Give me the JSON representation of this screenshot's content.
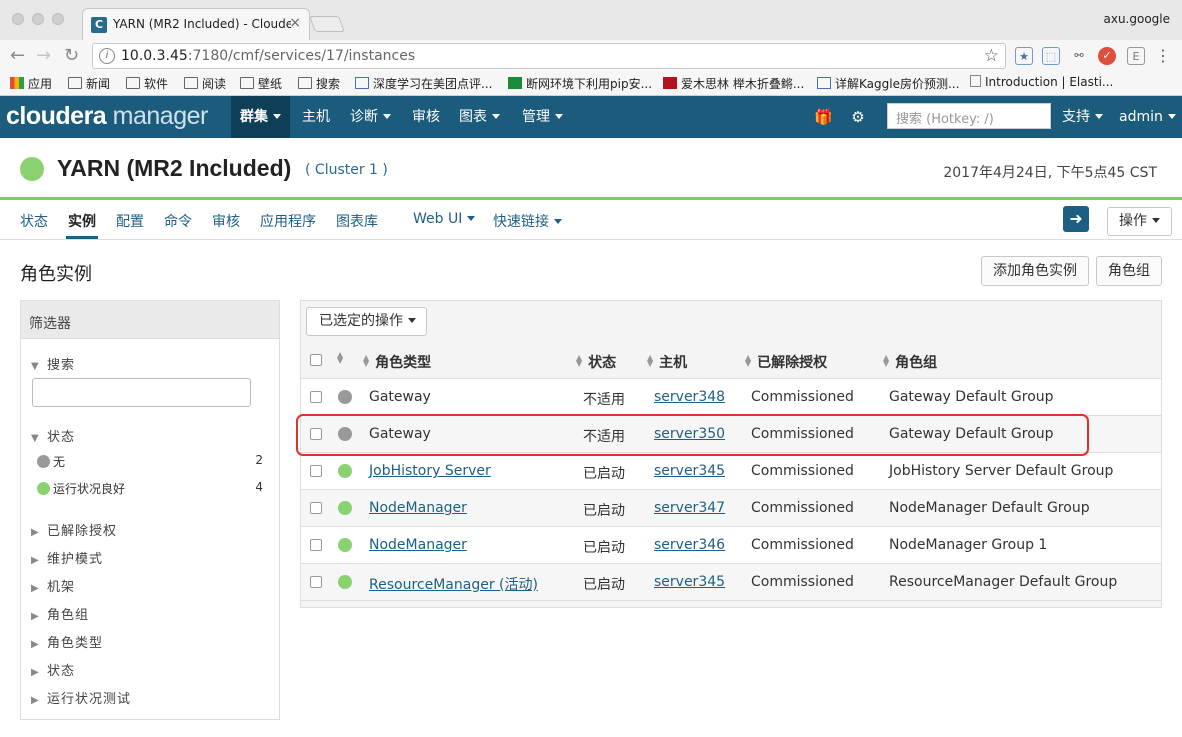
{
  "browser": {
    "tab_title": "YARN (MR2 Included) - Cloude",
    "tab_favicon": "C",
    "profile": "axu.google",
    "url_host": "10.0.3.45",
    "url_rest": ":7180/cmf/services/17/instances",
    "bookmarks": [
      {
        "label": "应用",
        "icon": "apps-icon"
      },
      {
        "label": "新闻",
        "icon": "folder-icon"
      },
      {
        "label": "软件",
        "icon": "folder-icon"
      },
      {
        "label": "阅读",
        "icon": "folder-icon"
      },
      {
        "label": "壁纸",
        "icon": "folder-icon"
      },
      {
        "label": "搜索",
        "icon": "folder-icon"
      },
      {
        "label": "深度学习在美团点评...",
        "icon": "chart-icon"
      },
      {
        "label": "断网环境下利用pip安...",
        "icon": "sf-icon"
      },
      {
        "label": "爱木思林 榉木折叠鳉...",
        "icon": "t-icon"
      },
      {
        "label": "详解Kaggle房价预测...",
        "icon": "chart-icon"
      },
      {
        "label": "Introduction | Elasti...",
        "icon": "page-icon"
      }
    ]
  },
  "nav": {
    "logo_a": "cloudera",
    "logo_b": "manager",
    "items": [
      "群集",
      "主机",
      "诊断",
      "审核",
      "图表",
      "管理"
    ],
    "search_placeholder": "搜索 (Hotkey: /)",
    "support": "支持",
    "user": "admin"
  },
  "service": {
    "title": "YARN (MR2 Included)",
    "cluster": "( Cluster 1 )",
    "datetime": "2017年4月24日, 下午5点45 CST"
  },
  "subnav": {
    "items": [
      "状态",
      "实例",
      "配置",
      "命令",
      "审核",
      "应用程序",
      "图表库",
      "Web UI",
      "快速链接"
    ],
    "ops": "操作"
  },
  "section": {
    "title": "角色实例",
    "add_button": "添加角色实例",
    "role_group_button": "角色组"
  },
  "filter": {
    "header": "筛选器",
    "search": "搜索",
    "status": "状态",
    "options": [
      {
        "label": "无",
        "count": "2",
        "color": "#999999"
      },
      {
        "label": "运行状况良好",
        "count": "4",
        "color": "#8ad26f"
      }
    ],
    "collapsed": [
      "已解除授权",
      "维护模式",
      "机架",
      "角色组",
      "角色类型",
      "状态",
      "运行状况测试"
    ]
  },
  "table": {
    "selected_action": "已选定的操作",
    "headers": [
      "角色类型",
      "状态",
      "主机",
      "已解除授权",
      "角色组"
    ],
    "rows": [
      {
        "role": "Gateway",
        "state": "不适用",
        "host": "server348",
        "decom": "Commissioned",
        "group": "Gateway Default Group",
        "color": "#999999",
        "link": false
      },
      {
        "role": "Gateway",
        "state": "不适用",
        "host": "server350",
        "decom": "Commissioned",
        "group": "Gateway Default Group",
        "color": "#999999",
        "link": false
      },
      {
        "role": "JobHistory Server",
        "state": "已启动",
        "host": "server345",
        "decom": "Commissioned",
        "group": "JobHistory Server Default Group",
        "color": "#8ad26f",
        "link": true
      },
      {
        "role": "NodeManager",
        "state": "已启动",
        "host": "server347",
        "decom": "Commissioned",
        "group": "NodeManager Default Group",
        "color": "#8ad26f",
        "link": true
      },
      {
        "role": "NodeManager",
        "state": "已启动",
        "host": "server346",
        "decom": "Commissioned",
        "group": "NodeManager Group 1",
        "color": "#8ad26f",
        "link": true
      },
      {
        "role": "ResourceManager (活动)",
        "state": "已启动",
        "host": "server345",
        "decom": "Commissioned",
        "group": "ResourceManager Default Group",
        "color": "#8ad26f",
        "link": true
      }
    ]
  }
}
